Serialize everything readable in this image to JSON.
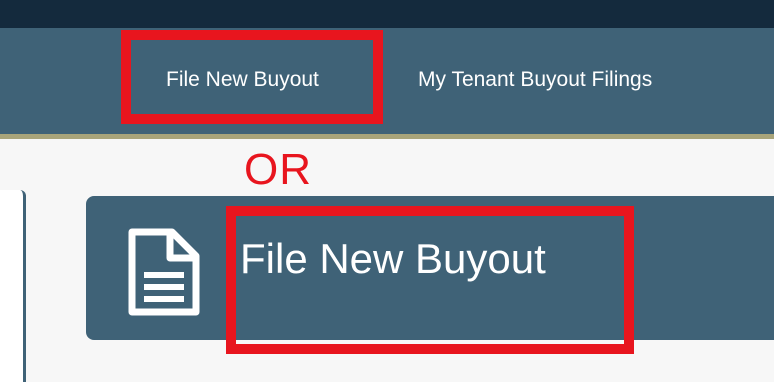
{
  "navbar": {
    "links": [
      {
        "label": "File New Buyout"
      },
      {
        "label": "My Tenant Buyout Filings"
      }
    ]
  },
  "annotation": {
    "or_text": "OR",
    "highlight_color": "#e8151e"
  },
  "card": {
    "title": "File New Buyout",
    "icon": "document-icon"
  },
  "colors": {
    "nav_background": "#3f6277",
    "top_strip": "#142a3d",
    "accent_line": "#a8a47a",
    "card_background": "#3f6277"
  }
}
